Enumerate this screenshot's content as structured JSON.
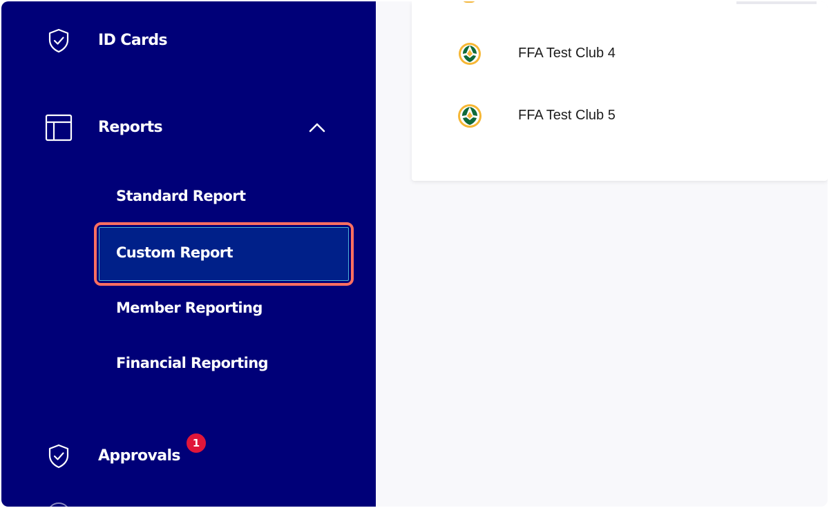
{
  "sidebar": {
    "id_cards": {
      "label": "ID Cards",
      "icon": "shield-check-icon"
    },
    "reports": {
      "label": "Reports",
      "icon": "layout-icon",
      "expanded": true,
      "children": [
        {
          "label": "Standard Report"
        },
        {
          "label": "Custom Report",
          "selected": true
        },
        {
          "label": "Member Reporting"
        },
        {
          "label": "Financial Reporting"
        }
      ]
    },
    "approvals": {
      "label": "Approvals",
      "icon": "shield-check-icon",
      "badge": "1"
    }
  },
  "clubs": [
    {
      "name": "FFA Test Club 4",
      "logo": "football-club-logo"
    },
    {
      "name": "FFA Test Club 5",
      "logo": "football-club-logo"
    }
  ],
  "colors": {
    "sidebar_bg": "#000078",
    "selected_bg": "#002089",
    "highlight_border": "#ff6f61",
    "badge": "#e0163a"
  }
}
